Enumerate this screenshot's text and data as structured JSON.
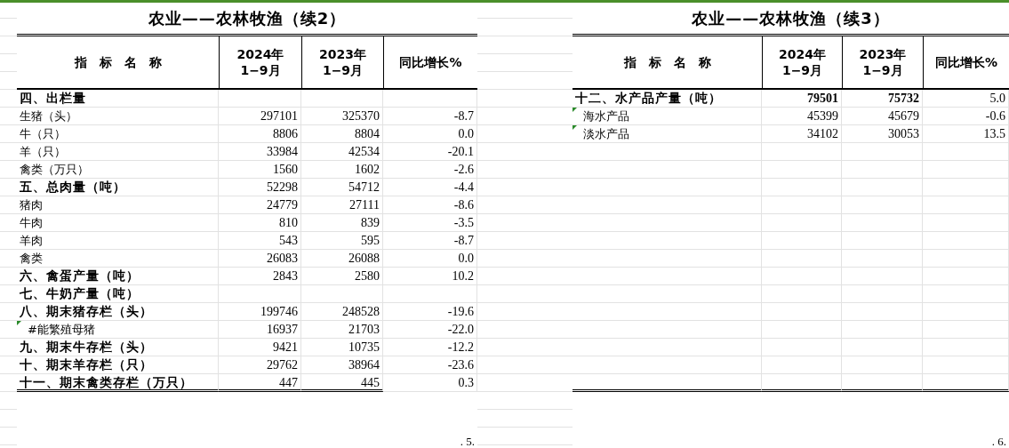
{
  "tables": [
    {
      "title": "农业——农林牧渔（续2）",
      "bold_section_values": false,
      "rule_spans_change_column": false,
      "page_number": ". 5.",
      "columns": [
        "指　标　名　称",
        "2024年\n1−9月",
        "2023年\n1−9月",
        "同比增长%"
      ],
      "rows": [
        {
          "kind": "section",
          "name": "四、出栏量"
        },
        {
          "kind": "item",
          "name": "生猪（头）",
          "values": [
            "297101",
            "325370",
            "-8.7"
          ]
        },
        {
          "kind": "item",
          "name": "牛（只）",
          "values": [
            "8806",
            "8804",
            "0.0"
          ]
        },
        {
          "kind": "item",
          "name": "羊（只）",
          "values": [
            "33984",
            "42534",
            "-20.1"
          ]
        },
        {
          "kind": "item",
          "name": "禽类（万只）",
          "values": [
            "1560",
            "1602",
            "-2.6"
          ]
        },
        {
          "kind": "section",
          "name": "五、总肉量（吨）",
          "values": [
            "52298",
            "54712",
            "-4.4"
          ]
        },
        {
          "kind": "item",
          "name": "猪肉",
          "values": [
            "24779",
            "27111",
            "-8.6"
          ]
        },
        {
          "kind": "item",
          "name": "牛肉",
          "values": [
            "810",
            "839",
            "-3.5"
          ]
        },
        {
          "kind": "item",
          "name": "羊肉",
          "values": [
            "543",
            "595",
            "-8.7"
          ]
        },
        {
          "kind": "item",
          "name": "禽类",
          "values": [
            "26083",
            "26088",
            "0.0"
          ]
        },
        {
          "kind": "section",
          "name": "六、禽蛋产量（吨）",
          "values": [
            "2843",
            "2580",
            "10.2"
          ]
        },
        {
          "kind": "section",
          "name": "七、牛奶产量（吨）"
        },
        {
          "kind": "section",
          "name": "八、期末猪存栏（头）",
          "values": [
            "199746",
            "248528",
            "-19.6"
          ]
        },
        {
          "kind": "sub",
          "name": "#能繁殖母猪",
          "values": [
            "16937",
            "21703",
            "-22.0"
          ]
        },
        {
          "kind": "section",
          "name": "九、期末牛存栏（头）",
          "values": [
            "9421",
            "10735",
            "-12.2"
          ]
        },
        {
          "kind": "section",
          "name": "十、期末羊存栏（只）",
          "values": [
            "29762",
            "38964",
            "-23.6"
          ]
        },
        {
          "kind": "section",
          "name": "十一、期末禽类存栏（万只）",
          "values": [
            "447",
            "445",
            "0.3"
          ]
        }
      ]
    },
    {
      "title": "农业——农林牧渔（续3）",
      "bold_section_values": true,
      "rule_spans_change_column": true,
      "page_number": ". 6.",
      "columns": [
        "指　标　名　称",
        "2024年\n1−9月",
        "2023年\n1−9月",
        "同比增长%"
      ],
      "rows": [
        {
          "kind": "section",
          "name": "十二、水产品产量（吨）",
          "values": [
            "79501",
            "75732",
            "5.0"
          ]
        },
        {
          "kind": "sub",
          "name": "海水产品",
          "values": [
            "45399",
            "45679",
            "-0.6"
          ]
        },
        {
          "kind": "sub",
          "name": "淡水产品",
          "values": [
            "34102",
            "30053",
            "13.5"
          ]
        }
      ]
    }
  ]
}
